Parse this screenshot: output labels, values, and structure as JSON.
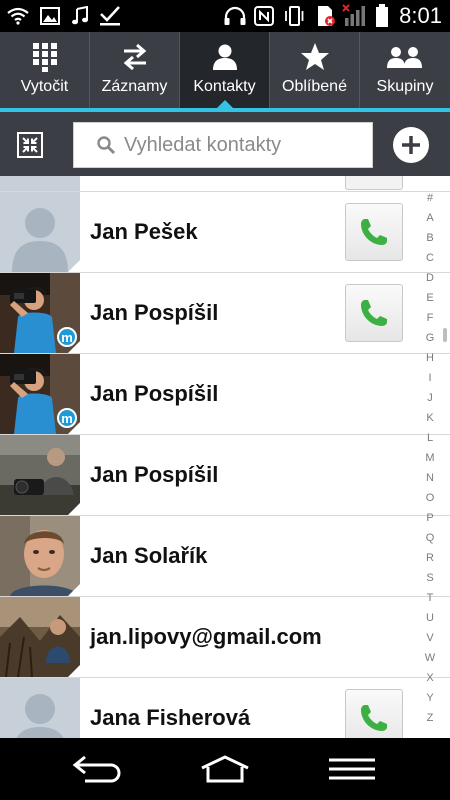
{
  "status_bar": {
    "time": "8:01",
    "icons": [
      "wifi-icon",
      "image-icon",
      "music-icon",
      "checkmark-icon",
      "headphones-icon",
      "nfc-icon",
      "vibrate-icon",
      "sim-error-icon",
      "signal-icon",
      "battery-icon"
    ]
  },
  "tabs": [
    {
      "label": "Vytočit",
      "icon": "dialpad-icon",
      "active": false
    },
    {
      "label": "Záznamy",
      "icon": "call-log-icon",
      "active": false
    },
    {
      "label": "Kontakty",
      "icon": "person-icon",
      "active": true
    },
    {
      "label": "Oblíbené",
      "icon": "star-icon",
      "active": false
    },
    {
      "label": "Skupiny",
      "icon": "group-icon",
      "active": false
    }
  ],
  "search": {
    "placeholder": "Vyhledat kontakty"
  },
  "contacts": [
    {
      "name": "Jan Pešek",
      "avatar": "placeholder",
      "call_button": true
    },
    {
      "name": "Jan Pospíšil",
      "avatar": "photo",
      "call_button": true,
      "badge": "m"
    },
    {
      "name": "Jan Pospíšil",
      "avatar": "photo",
      "call_button": false,
      "badge": "m"
    },
    {
      "name": "Jan Pospíšil",
      "avatar": "photo",
      "call_button": false
    },
    {
      "name": "Jan Solařík",
      "avatar": "photo",
      "call_button": false
    },
    {
      "name": "jan.lipovy@gmail.com",
      "avatar": "photo",
      "call_button": false
    },
    {
      "name": "Jana Fisherová",
      "avatar": "placeholder",
      "call_button": true
    }
  ],
  "alphabet_index": [
    "#",
    "A",
    "B",
    "C",
    "D",
    "E",
    "F",
    "G",
    "H",
    "I",
    "J",
    "K",
    "L",
    "M",
    "N",
    "O",
    "P",
    "Q",
    "R",
    "S",
    "T",
    "U",
    "V",
    "W",
    "X",
    "Y",
    "Z"
  ],
  "navigation": [
    "back-icon",
    "home-icon",
    "menu-icon"
  ],
  "colors": {
    "accent": "#35c3e3",
    "tab_bar": "#3b3f45",
    "active_tab": "#23262a",
    "call_green": "#3cb043",
    "badge_blue": "#1e9ad6"
  }
}
